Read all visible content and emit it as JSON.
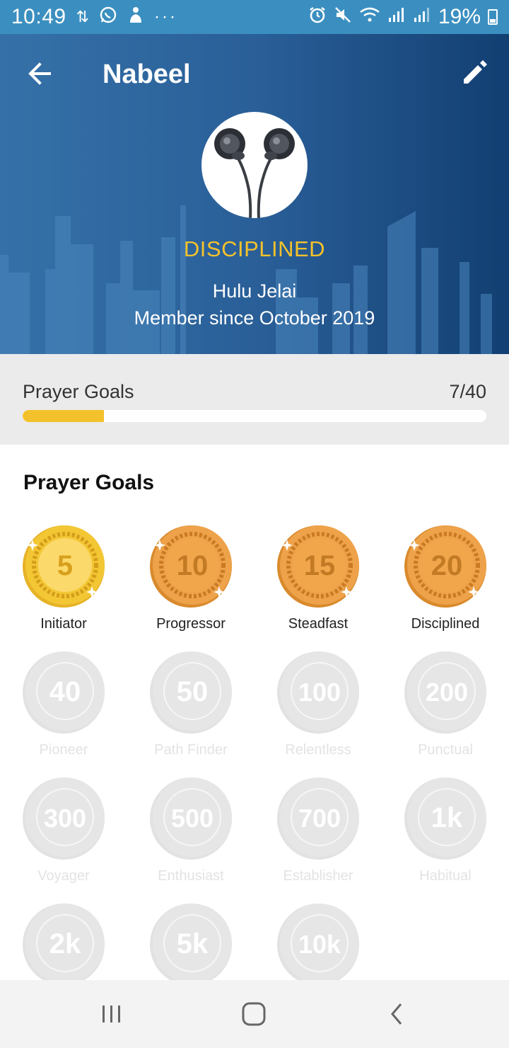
{
  "status_bar": {
    "time": "10:49",
    "battery": "19%"
  },
  "header": {
    "title": "Nabeel",
    "rank": "DISCIPLINED",
    "location": "Hulu Jelai",
    "member_since": "Member since October 2019"
  },
  "progress": {
    "label": "Prayer Goals",
    "count": "7/40",
    "fraction": 0.175,
    "color": "#f3c12b"
  },
  "goals": {
    "title": "Prayer Goals",
    "badges": [
      {
        "value": "5",
        "name": "Initiator",
        "earned": true,
        "tier": "gold"
      },
      {
        "value": "10",
        "name": "Progressor",
        "earned": true,
        "tier": "bronze"
      },
      {
        "value": "15",
        "name": "Steadfast",
        "earned": true,
        "tier": "bronze"
      },
      {
        "value": "20",
        "name": "Disciplined",
        "earned": true,
        "tier": "bronze"
      },
      {
        "value": "40",
        "name": "Pioneer",
        "earned": false
      },
      {
        "value": "50",
        "name": "Path Finder",
        "earned": false
      },
      {
        "value": "100",
        "name": "Relentless",
        "earned": false
      },
      {
        "value": "200",
        "name": "Punctual",
        "earned": false
      },
      {
        "value": "300",
        "name": "Voyager",
        "earned": false
      },
      {
        "value": "500",
        "name": "Enthusiast",
        "earned": false
      },
      {
        "value": "700",
        "name": "Establisher",
        "earned": false
      },
      {
        "value": "1k",
        "name": "Habitual",
        "earned": false
      },
      {
        "value": "2k",
        "name": "",
        "earned": false
      },
      {
        "value": "5k",
        "name": "",
        "earned": false
      },
      {
        "value": "10k",
        "name": "",
        "earned": false
      }
    ]
  },
  "colors": {
    "accent_gold": "#f4c22b",
    "header_blue": "#2a5f98",
    "status_blue": "#3b8fc0"
  }
}
